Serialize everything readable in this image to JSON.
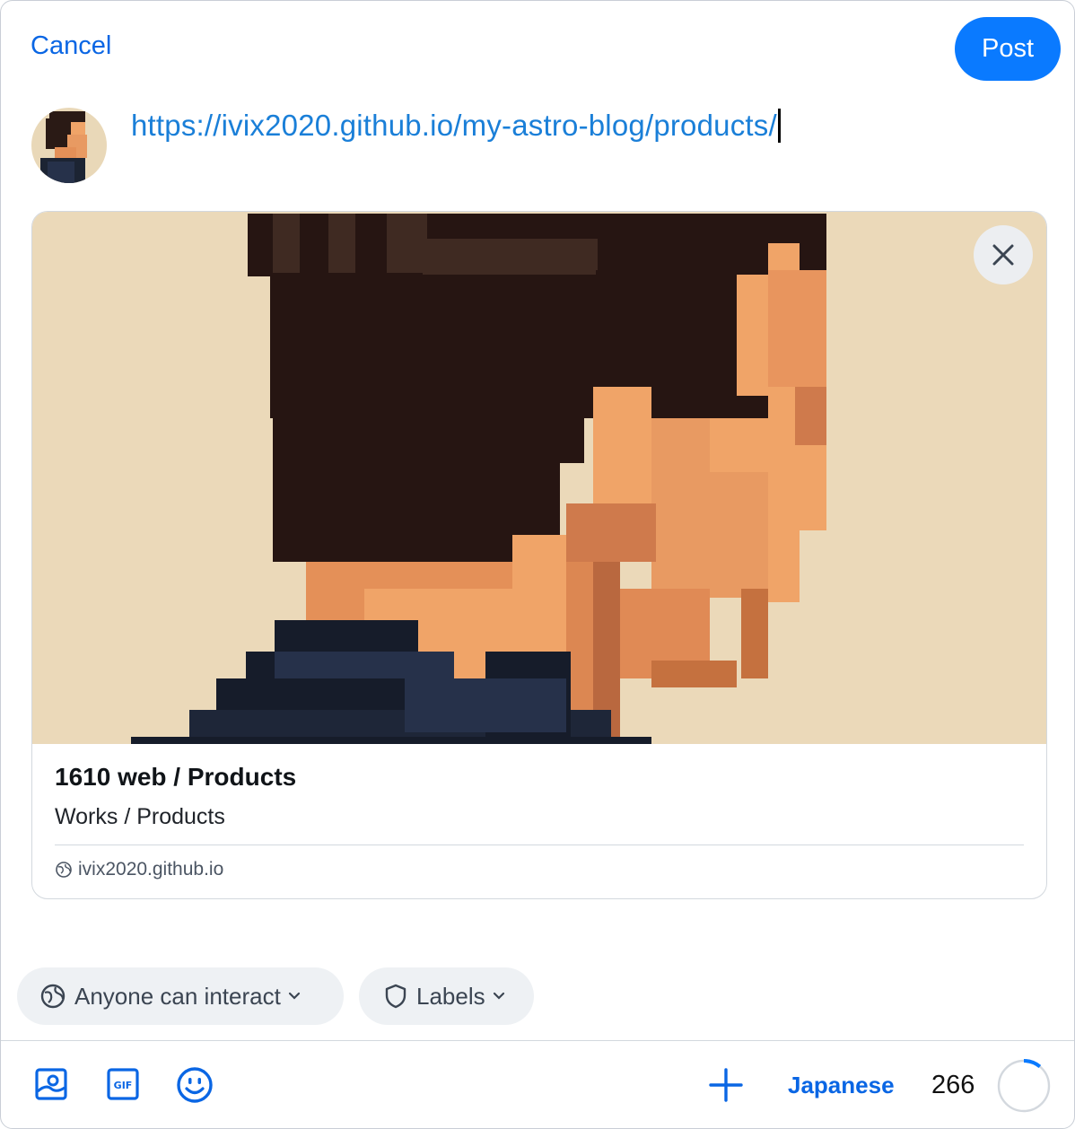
{
  "header": {
    "cancel_label": "Cancel",
    "post_label": "Post"
  },
  "composer": {
    "text": "https://ivix2020.github.io/my-astro-blog/products/"
  },
  "link_card": {
    "title": "1610 web / Products",
    "description": "Works / Products",
    "domain": "ivix2020.github.io",
    "image_icon": "pixel-art-portrait"
  },
  "settings": {
    "interaction_label": "Anyone can interact",
    "labels_label": "Labels"
  },
  "toolbar": {
    "icons": [
      "image-icon",
      "gif-icon",
      "emoji-icon",
      "plus-icon"
    ],
    "language": "Japanese",
    "char_remaining": "266",
    "char_used_fraction": 0.11
  },
  "colors": {
    "accent": "#0a7aff",
    "link": "#1a7fd8",
    "pill_bg": "#eef1f4"
  }
}
